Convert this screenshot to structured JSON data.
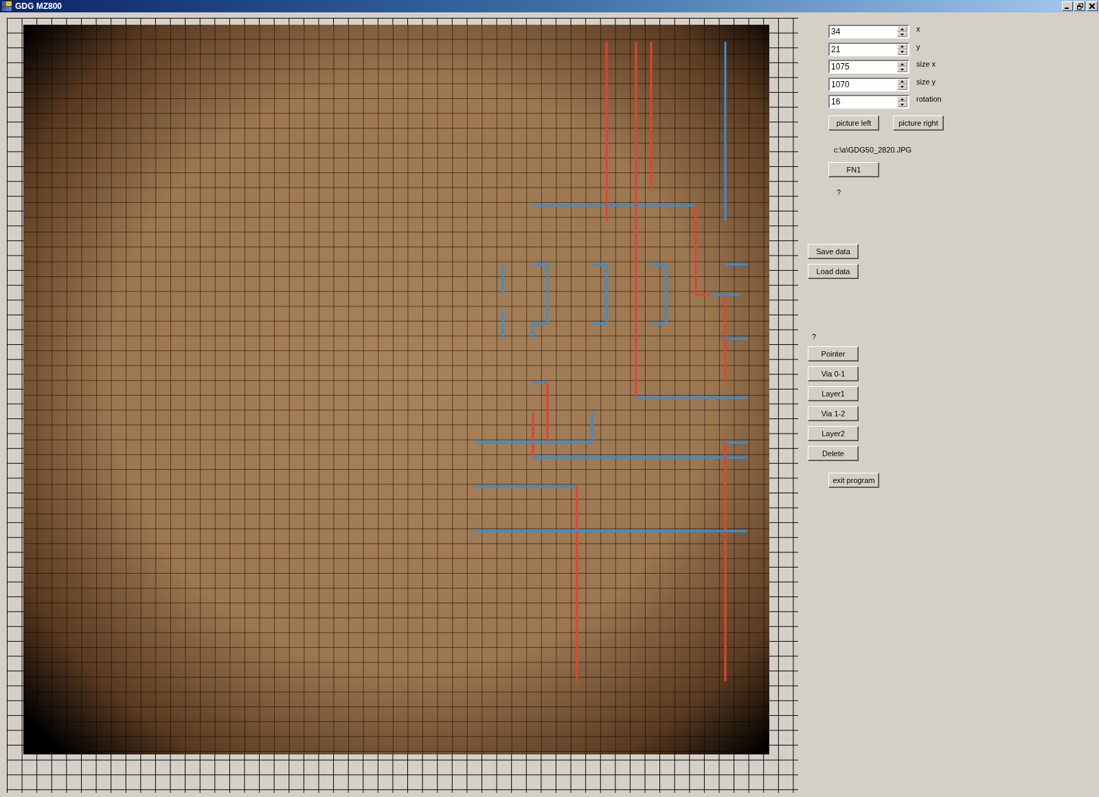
{
  "window": {
    "title": "GDG MZ800"
  },
  "fields": [
    {
      "value": "34",
      "label": "x"
    },
    {
      "value": "21",
      "label": "y"
    },
    {
      "value": "1075",
      "label": "size x"
    },
    {
      "value": "1070",
      "label": "size y"
    },
    {
      "value": "16",
      "label": "rotation"
    }
  ],
  "picture_buttons": [
    "picture left",
    "picture right"
  ],
  "file_path": "c:\\a\\GDG50_2820.JPG",
  "fn_button": "FN1",
  "status_1": "?",
  "data_buttons": [
    "Save data",
    "Load data"
  ],
  "status_2": "?",
  "tool_buttons": [
    "Pointer",
    "Via 0-1",
    "Layer1",
    "Via 1-2",
    "Layer2",
    "Delete"
  ],
  "exit_button": "exit program"
}
